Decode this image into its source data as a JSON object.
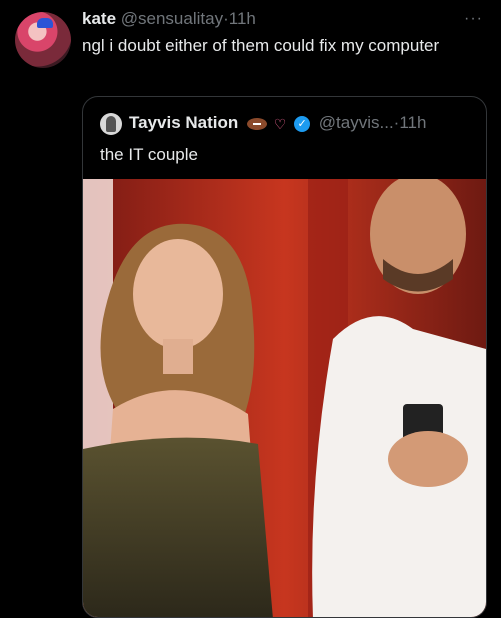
{
  "tweet": {
    "display_name": "kate",
    "handle": "@sensualitay",
    "separator": "·",
    "time": "11h",
    "text": "ngl i doubt either of them could fix my computer",
    "more_icon": "more-icon"
  },
  "quoted": {
    "display_name": "Tayvis Nation",
    "handle": "@tayvis...",
    "separator": "·",
    "time": "11h",
    "text": "the IT couple",
    "badges": [
      "football-icon",
      "heart-hands-icon",
      "verified-icon"
    ]
  },
  "colors": {
    "background": "#000000",
    "text_primary": "#e7e9ea",
    "text_secondary": "#71767b",
    "border": "#333639",
    "verified": "#1d9bf0"
  }
}
